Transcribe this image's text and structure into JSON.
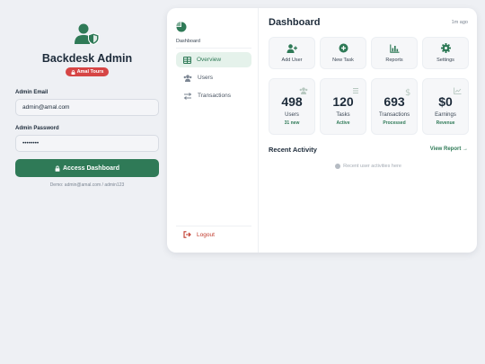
{
  "login": {
    "logo_icon": "user-shield-icon",
    "title": "Backdesk Admin",
    "badge": "Amal Tours",
    "email_label": "Admin Email",
    "email_value": "admin@amal.com",
    "password_label": "Admin Password",
    "password_value": "••••••••",
    "submit_label": "Access Dashboard",
    "demo_text": "Demo: admin@amal.com / admin123"
  },
  "sidebar": {
    "brand_icon": "pie-chart-icon",
    "brand_label": "Dashboard",
    "items": [
      {
        "label": "Overview",
        "icon": "table-icon",
        "active": true
      },
      {
        "label": "Users",
        "icon": "users-icon",
        "active": false
      },
      {
        "label": "Transactions",
        "icon": "exchange-icon",
        "active": false
      }
    ],
    "logout_label": "Logout"
  },
  "header": {
    "title": "Dashboard",
    "time": "1m ago"
  },
  "quick_actions": [
    {
      "label": "Add User",
      "icon": "user-plus-icon"
    },
    {
      "label": "New Task",
      "icon": "plus-circle-icon"
    },
    {
      "label": "Reports",
      "icon": "bar-chart-icon"
    },
    {
      "label": "Settings",
      "icon": "gear-icon"
    }
  ],
  "stats": [
    {
      "value": "498",
      "label": "Users",
      "sub": "31 new",
      "icon": "users-icon"
    },
    {
      "value": "120",
      "label": "Tasks",
      "sub": "Active",
      "icon": "list-icon"
    },
    {
      "value": "693",
      "label": "Transactions",
      "sub": "Processed",
      "icon": "dollar-icon"
    },
    {
      "value": "$0",
      "label": "Earnings",
      "sub": "Revenue",
      "icon": "line-chart-icon"
    }
  ],
  "activity": {
    "title": "Recent Activity",
    "view_link": "View Report →",
    "empty_text": "Recent user activities here"
  },
  "colors": {
    "primary": "#2f7a57",
    "danger": "#d64545",
    "background": "#eef0f4"
  }
}
